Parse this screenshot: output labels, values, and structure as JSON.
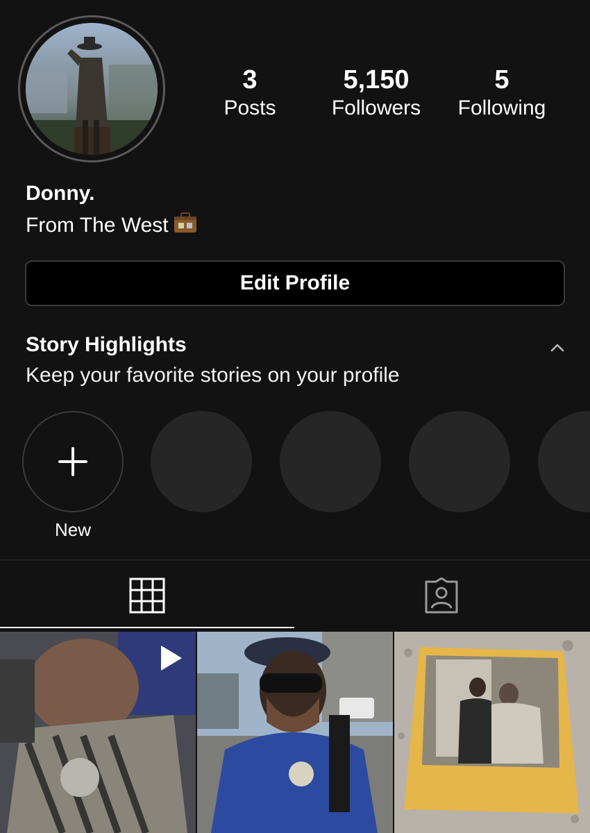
{
  "profile": {
    "name": "Donny.",
    "bio": "From The West",
    "bio_emoji": "briefcase-emoji"
  },
  "stats": {
    "posts": {
      "value": "3",
      "label": "Posts"
    },
    "followers": {
      "value": "5,150",
      "label": "Followers"
    },
    "following": {
      "value": "5",
      "label": "Following"
    }
  },
  "actions": {
    "edit_profile": "Edit Profile"
  },
  "highlights": {
    "title": "Story Highlights",
    "subtitle": "Keep your favorite stories on your profile",
    "new_label": "New",
    "placeholders": 4
  },
  "tabs": [
    {
      "name": "grid",
      "icon": "grid-icon",
      "active": true
    },
    {
      "name": "tagged",
      "icon": "tagged-icon",
      "active": false
    }
  ],
  "posts": [
    {
      "type": "video",
      "icon": "play-icon"
    },
    {
      "type": "photo"
    },
    {
      "type": "photo"
    }
  ],
  "colors": {
    "background": "#121212",
    "text": "#ffffff",
    "highlight_placeholder": "#262626",
    "border": "#3a3a3a"
  }
}
